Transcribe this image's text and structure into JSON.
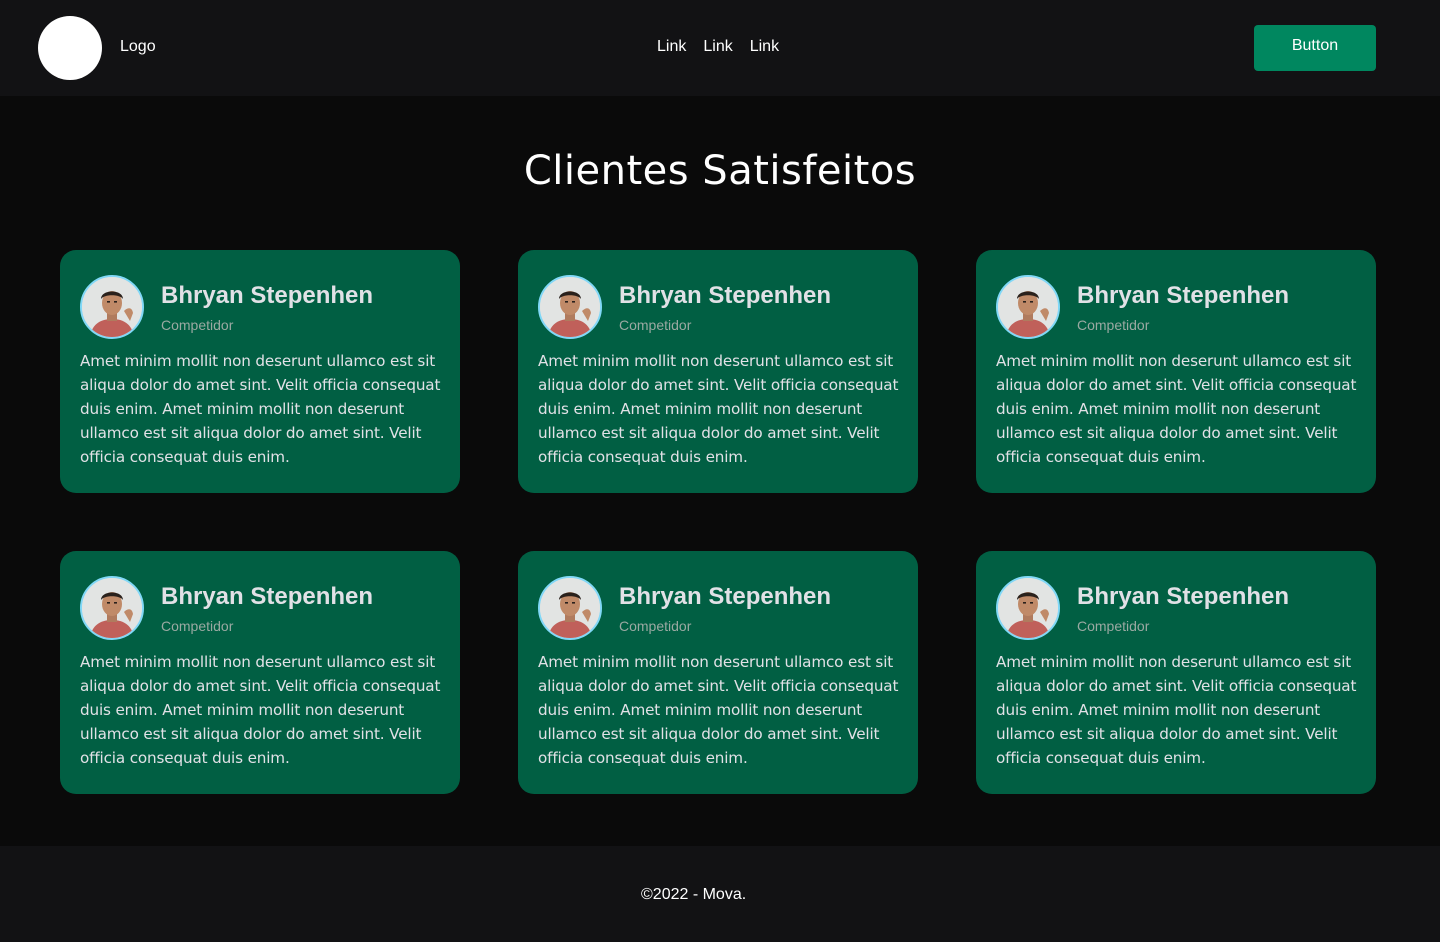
{
  "header": {
    "logo_label": "Logo",
    "nav_links": [
      "Link",
      "Link",
      "Link"
    ],
    "button_label": "Button",
    "accent_color": "#00875f"
  },
  "section": {
    "title": "Clientes Satisfeitos"
  },
  "testimonials": [
    {
      "name": "Bhryan Stepenhen",
      "role": "Competidor",
      "text": "Amet minim mollit non deserunt ullamco est sit aliqua dolor do amet sint. Velit officia consequat duis enim. Amet minim mollit non deserunt ullamco est sit aliqua dolor do amet sint. Velit officia consequat duis enim."
    },
    {
      "name": "Bhryan Stepenhen",
      "role": "Competidor",
      "text": "Amet minim mollit non deserunt ullamco est sit aliqua dolor do amet sint. Velit officia consequat duis enim. Amet minim mollit non deserunt ullamco est sit aliqua dolor do amet sint. Velit officia consequat duis enim."
    },
    {
      "name": "Bhryan Stepenhen",
      "role": "Competidor",
      "text": "Amet minim mollit non deserunt ullamco est sit aliqua dolor do amet sint. Velit officia consequat duis enim. Amet minim mollit non deserunt ullamco est sit aliqua dolor do amet sint. Velit officia consequat duis enim."
    },
    {
      "name": "Bhryan Stepenhen",
      "role": "Competidor",
      "text": "Amet minim mollit non deserunt ullamco est sit aliqua dolor do amet sint. Velit officia consequat duis enim. Amet minim mollit non deserunt ullamco est sit aliqua dolor do amet sint. Velit officia consequat duis enim."
    },
    {
      "name": "Bhryan Stepenhen",
      "role": "Competidor",
      "text": "Amet minim mollit non deserunt ullamco est sit aliqua dolor do amet sint. Velit officia consequat duis enim. Amet minim mollit non deserunt ullamco est sit aliqua dolor do amet sint. Velit officia consequat duis enim."
    },
    {
      "name": "Bhryan Stepenhen",
      "role": "Competidor",
      "text": "Amet minim mollit non deserunt ullamco est sit aliqua dolor do amet sint. Velit officia consequat duis enim. Amet minim mollit non deserunt ullamco est sit aliqua dolor do amet sint. Velit officia consequat duis enim."
    }
  ],
  "card_color": "#015f43",
  "avatar_icon": "user-photo",
  "footer": {
    "copyright": "©2022 - Mova."
  }
}
